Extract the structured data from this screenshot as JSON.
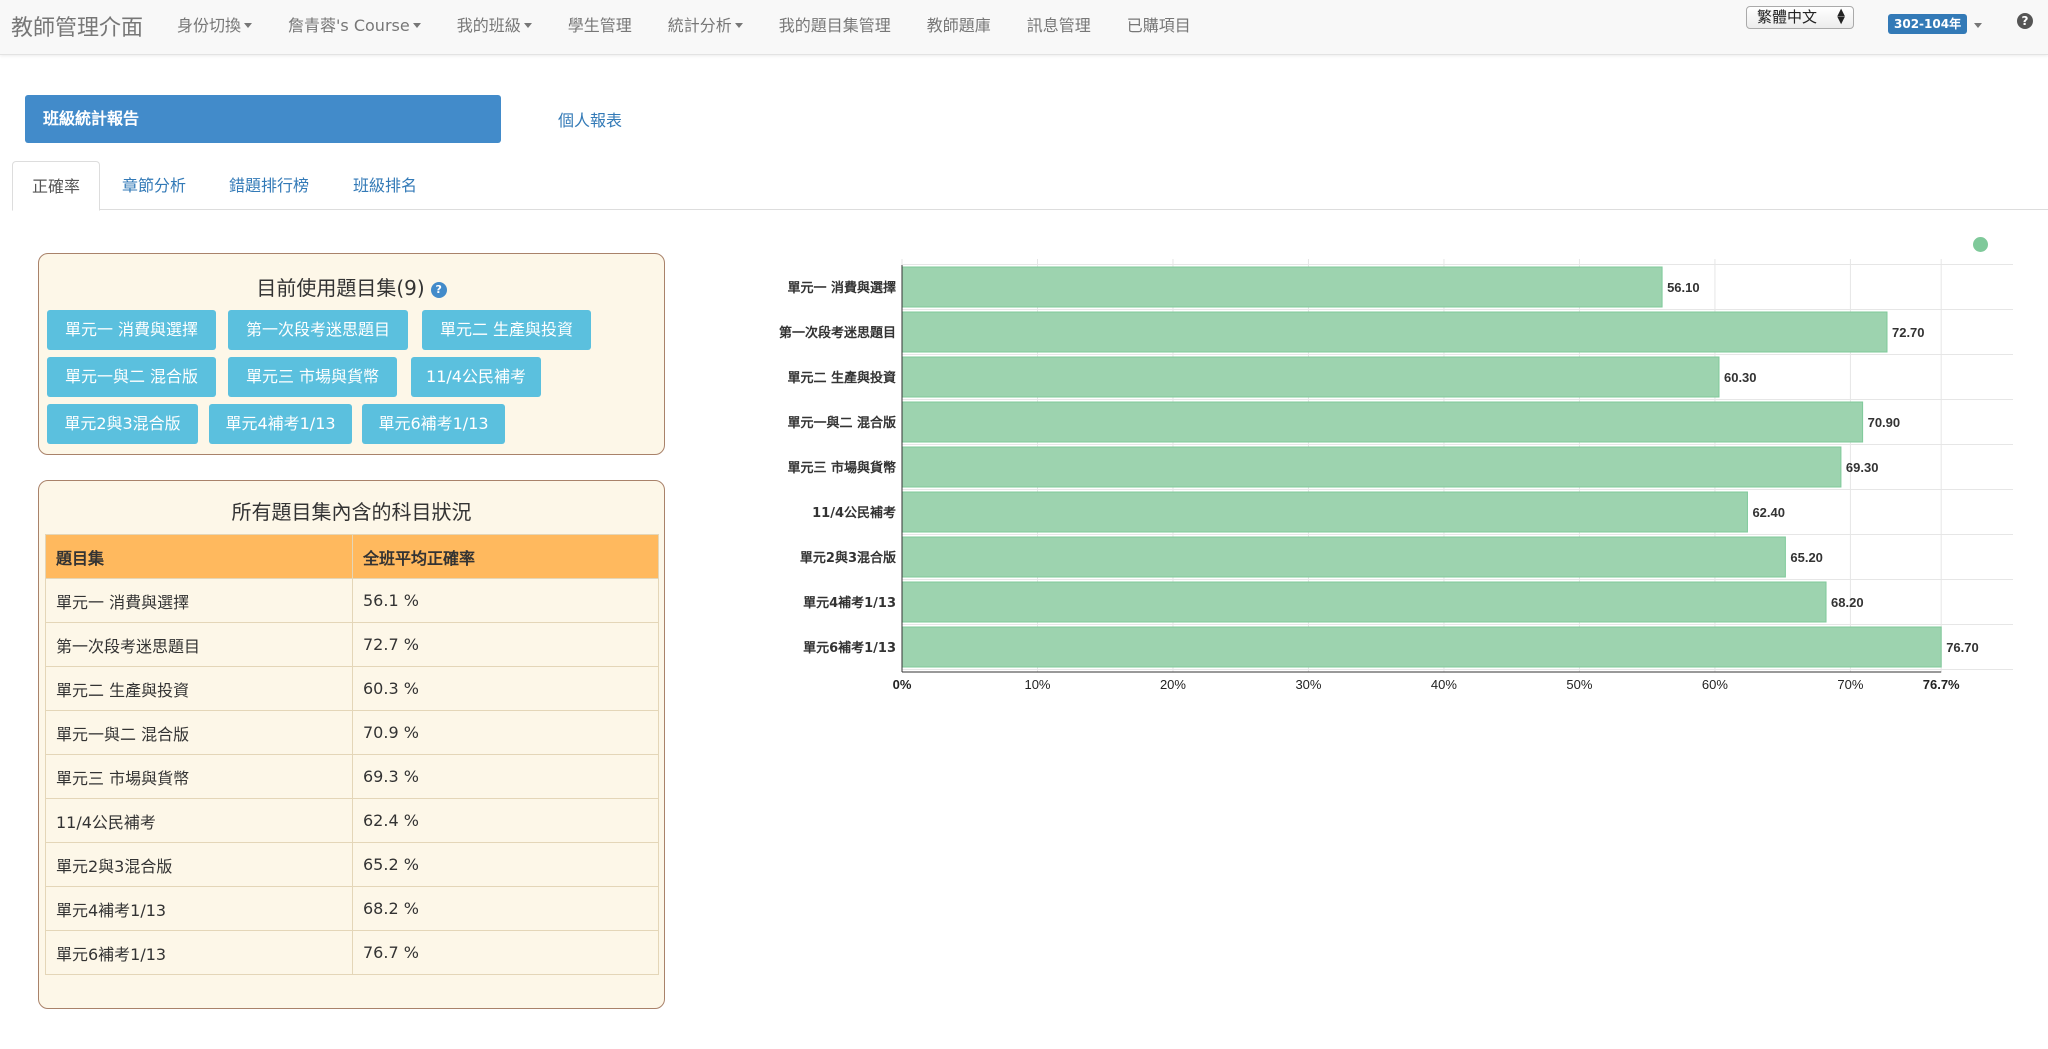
{
  "nav": {
    "brand": "教師管理介面",
    "items": [
      {
        "label": "身份切換",
        "dropdown": true
      },
      {
        "label": "詹青蓉's Course",
        "dropdown": true
      },
      {
        "label": "我的班級",
        "dropdown": true
      },
      {
        "label": "學生管理",
        "dropdown": false
      },
      {
        "label": "統計分析",
        "dropdown": true
      },
      {
        "label": "我的題目集管理",
        "dropdown": false
      },
      {
        "label": "教師題庫",
        "dropdown": false
      },
      {
        "label": "訊息管理",
        "dropdown": false
      },
      {
        "label": "已購項目",
        "dropdown": false
      }
    ],
    "language": "繁體中文",
    "year_badge": "302-104年",
    "help": "?"
  },
  "report": {
    "class_report": "班級統計報告",
    "personal_report": "個人報表"
  },
  "tabs": [
    "正確率",
    "章節分析",
    "錯題排行榜",
    "班級排名"
  ],
  "sets_panel": {
    "title": "目前使用題目集(9)",
    "help": "?",
    "chips": [
      "單元一 消費與選擇",
      "第一次段考迷思題目",
      "單元二 生產與投資",
      "單元一與二 混合版",
      "單元三 市場與貨幣",
      "11/4公民補考",
      "單元2與3混合版",
      "單元4補考1/13",
      "單元6補考1/13"
    ]
  },
  "table_panel": {
    "title": "所有題目集內含的科目狀況",
    "headers": [
      "題目集",
      "全班平均正確率"
    ],
    "rows": [
      [
        "單元一 消費與選擇",
        "56.1 %"
      ],
      [
        "第一次段考迷思題目",
        "72.7 %"
      ],
      [
        "單元二 生產與投資",
        "60.3 %"
      ],
      [
        "單元一與二 混合版",
        "70.9 %"
      ],
      [
        "單元三 市場與貨幣",
        "69.3 %"
      ],
      [
        "11/4公民補考",
        "62.4 %"
      ],
      [
        "單元2與3混合版",
        "65.2 %"
      ],
      [
        "單元4補考1/13",
        "68.2 %"
      ],
      [
        "單元6補考1/13",
        "76.7 %"
      ]
    ]
  },
  "chart_data": {
    "type": "bar",
    "orientation": "horizontal",
    "categories": [
      "單元一 消費與選擇",
      "第一次段考迷思題目",
      "單元二 生產與投資",
      "單元一與二 混合版",
      "單元三 市場與貨幣",
      "11/4公民補考",
      "單元2與3混合版",
      "單元4補考1/13",
      "單元6補考1/13"
    ],
    "values": [
      56.1,
      72.7,
      60.3,
      70.9,
      69.3,
      62.4,
      65.2,
      68.2,
      76.7
    ],
    "value_labels": [
      "56.10",
      "72.70",
      "60.30",
      "70.90",
      "69.30",
      "62.40",
      "65.20",
      "68.20",
      "76.70"
    ],
    "xticks": [
      "0%",
      "10%",
      "20%",
      "30%",
      "40%",
      "50%",
      "60%",
      "70%",
      "76.7%"
    ],
    "xtick_values": [
      0,
      10,
      20,
      30,
      40,
      50,
      60,
      70,
      76.7
    ],
    "xlim": [
      0,
      82
    ],
    "grid": true,
    "legend": "top-right",
    "bar_color": "#9dd3af",
    "bar_edge_color": "#7fc99a"
  }
}
